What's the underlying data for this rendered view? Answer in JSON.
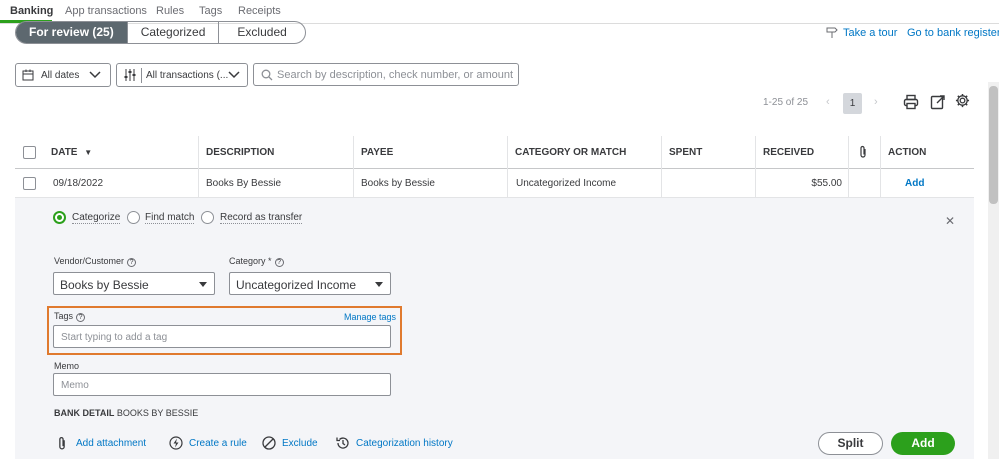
{
  "nav": {
    "tabs": [
      "Banking",
      "App transactions",
      "Rules",
      "Tags",
      "Receipts"
    ],
    "active_color": "#2ca01c"
  },
  "review_tabs": [
    "For review (25)",
    "Categorized",
    "Excluded"
  ],
  "links": {
    "take_tour": "Take a tour",
    "bank_register": "Go to bank register"
  },
  "filters": {
    "dates": "All dates",
    "transactions": "All transactions (...",
    "search_placeholder": "Search by description, check number, or amount"
  },
  "pager": {
    "range": "1-25 of 25",
    "page": "1"
  },
  "table": {
    "headers": [
      "DATE",
      "DESCRIPTION",
      "PAYEE",
      "CATEGORY OR MATCH",
      "SPENT",
      "RECEIVED",
      "ACTION"
    ],
    "row": {
      "date": "09/18/2022",
      "description": "Books By Bessie",
      "payee": "Books by Bessie",
      "category": "Uncategorized Income",
      "spent": "",
      "received": "$55.00",
      "action": "Add"
    }
  },
  "detail": {
    "options": [
      "Categorize",
      "Find match",
      "Record as transfer"
    ],
    "vendor_label": "Vendor/Customer",
    "vendor_value": "Books by Bessie",
    "category_label": "Category *",
    "category_value": "Uncategorized Income",
    "tags_label": "Tags",
    "manage_tags": "Manage tags",
    "tags_placeholder": "Start typing to add a tag",
    "memo_label": "Memo",
    "memo_placeholder": "Memo",
    "bank_detail_label": "BANK DETAIL",
    "bank_detail_value": "BOOKS BY BESSIE",
    "actions": [
      "Add attachment",
      "Create a rule",
      "Exclude",
      "Categorization history"
    ],
    "split": "Split",
    "add": "Add"
  },
  "colors": {
    "primary_green": "#2ca01c",
    "link_blue": "#0077c5",
    "highlight_orange": "#e07a2e"
  }
}
